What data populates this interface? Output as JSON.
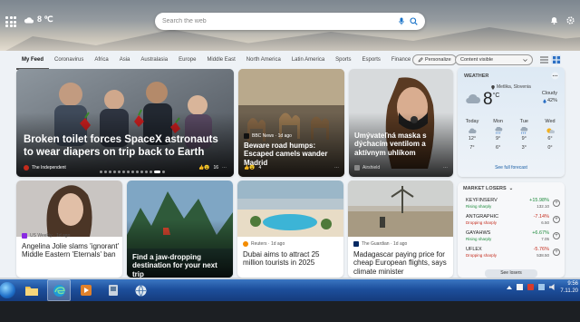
{
  "topbar": {
    "temp": "8 ℃",
    "search_placeholder": "Search the web"
  },
  "nav": {
    "tabs": [
      "My Feed",
      "Coronavirus",
      "Africa",
      "Asia",
      "Australasia",
      "Europe",
      "Middle East",
      "North America",
      "Latin America",
      "Sports",
      "Esports",
      "Finance"
    ],
    "personalize_label": "Personalize",
    "visibility_label": "Content visible"
  },
  "cards": {
    "c1": {
      "source": "The Independent",
      "title": "Broken toilet forces SpaceX astronauts to wear diapers on trip back to Earth",
      "likes": "16"
    },
    "c2": {
      "source": "BBC News · 1d ago",
      "title": "Beware road humps: Escaped camels wander Madrid",
      "likes": "4"
    },
    "c3": {
      "source": "Airshield",
      "title": "Umývateľná maska s dýchacím ventilom a aktívnym uhlíkom"
    },
    "c4": {
      "source": "US Weekly · 1d ago",
      "title": "Angelina Jolie slams 'ignorant' Middle Eastern 'Eternals' ban"
    },
    "c5": {
      "source": "",
      "title": "Find a jaw-dropping destination for your next trip"
    },
    "c6": {
      "source": "Reuters · 1d ago",
      "title": "Dubai aims to attract 25 million tourists in 2025"
    },
    "c7": {
      "source": "The Guardian · 1d ago",
      "title": "Madagascar paying price for cheap European flights, says climate minister"
    }
  },
  "weather": {
    "heading": "WEATHER",
    "location": "Metlika, Slovenia",
    "temp": "8",
    "unit": "°C",
    "condition": "Cloudy",
    "humidity": "42%",
    "days": [
      {
        "name": "Today",
        "hi": "12°",
        "lo": "7°"
      },
      {
        "name": "Mon",
        "hi": "9°",
        "lo": "6°"
      },
      {
        "name": "Tue",
        "hi": "9°",
        "lo": "3°"
      },
      {
        "name": "Wed",
        "hi": "6°",
        "lo": "0°"
      }
    ],
    "forecast_link": "See full forecast"
  },
  "market": {
    "heading": "MARKET LOSERS",
    "rows": [
      {
        "symbol": "KEYFINSERV",
        "status": "Rising sharply",
        "change": "+15.98%",
        "value": "132.10",
        "color": "#1e8a3c"
      },
      {
        "symbol": "ANTGRAPHIC",
        "status": "Dropping sharply",
        "change": "-7.14%",
        "value": "6.50",
        "color": "#c42b1c"
      },
      {
        "symbol": "GAYAHWS",
        "status": "Rising sharply",
        "change": "+6.67%",
        "value": "7.05",
        "color": "#1e8a3c"
      },
      {
        "symbol": "UFLEX",
        "status": "Dropping sharply",
        "change": "-5.76%",
        "value": "538.50",
        "color": "#c42b1c"
      }
    ],
    "see_more": "See losers"
  },
  "taskbar": {
    "time": "9:56",
    "date": "7.11.20"
  }
}
